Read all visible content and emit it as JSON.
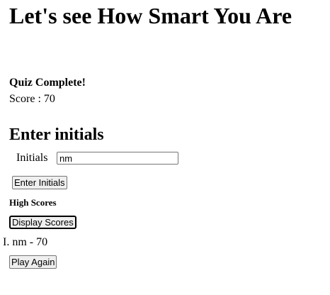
{
  "header": {
    "title": "Let's see How Smart You Are"
  },
  "result": {
    "heading": "Quiz Complete!",
    "score_label": "Score",
    "score_separator": " : ",
    "score_value": "70"
  },
  "initials": {
    "heading": "Enter initials",
    "label": "Initials",
    "value": "nm",
    "submit_label": "Enter Initials"
  },
  "high_scores": {
    "heading": "High Scores",
    "display_label": "Display Scores",
    "entries": [
      {
        "marker": "I.",
        "text": "nm - 70"
      }
    ]
  },
  "actions": {
    "play_again_label": "Play Again"
  }
}
